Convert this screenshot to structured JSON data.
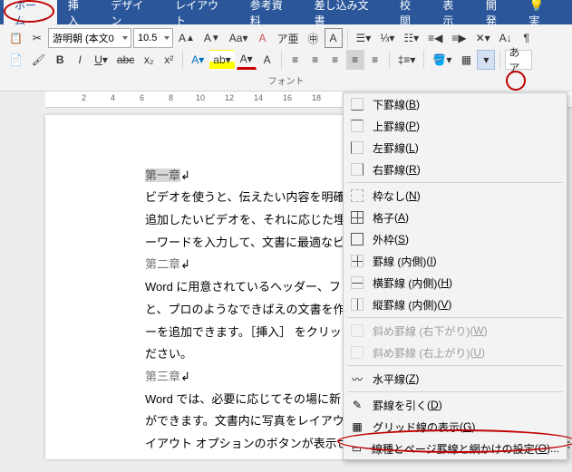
{
  "tabs": {
    "home": "ホーム",
    "insert": "挿入",
    "design": "デザイン",
    "layout": "レイアウト",
    "references": "参考資料",
    "mailings": "差し込み文書",
    "review": "校閲",
    "view": "表示",
    "developer": "開発"
  },
  "toolbar": {
    "font_name": "游明朝 (本文0",
    "font_size": "10.5",
    "group_font": "フォント"
  },
  "ruler": {
    "n2": "2",
    "n4": "4",
    "n6": "6",
    "n8": "8",
    "n10": "10",
    "n12": "12",
    "n14": "14",
    "n16": "16",
    "n18": "18"
  },
  "doc": {
    "ch1": "第一章",
    "p1": "ビデオを使うと、伝えたい内容を明確",
    "p2": "追加したいビデオを、それに応じた埋",
    "p3": "ーワードを入力して、文書に最適なビ",
    "ch2": "第二章",
    "p4": "Word に用意されているヘッダー、フ",
    "p5": "と、プロのようなできばえの文書を作",
    "p6": "ーを追加できます。［挿入］ をクリック",
    "p7": "ださい。",
    "ch3": "第三章",
    "p8": "Word では、必要に応じてその場に新",
    "p9": "ができます。文書内に写真をレイアウ",
    "p10": "イアウト オプションのボタンが表示されます。表で作業している場合は、行また"
  },
  "dropdown": {
    "bottom": "下罫線",
    "bottom_k": "B",
    "top": "上罫線",
    "top_k": "P",
    "left": "左罫線",
    "left_k": "L",
    "right": "右罫線",
    "right_k": "R",
    "none": "枠なし",
    "none_k": "N",
    "all": "格子",
    "all_k": "A",
    "outside": "外枠",
    "outside_k": "S",
    "inside": "罫線 (内側)",
    "inside_k": "I",
    "inside_h": "横罫線 (内側)",
    "inside_h_k": "H",
    "inside_v": "縦罫線 (内側)",
    "inside_v_k": "V",
    "diag_down": "斜め罫線 (右下がり)",
    "diag_down_k": "W",
    "diag_up": "斜め罫線 (右上がり)",
    "diag_up_k": "U",
    "hline": "水平線",
    "hline_k": "Z",
    "draw": "罫線を引く",
    "draw_k": "D",
    "grid": "グリッド線の表示",
    "grid_k": "G",
    "settings": "線種とページ罫線と網かけの設定",
    "settings_k": "O",
    "settings_suffix": "..."
  }
}
